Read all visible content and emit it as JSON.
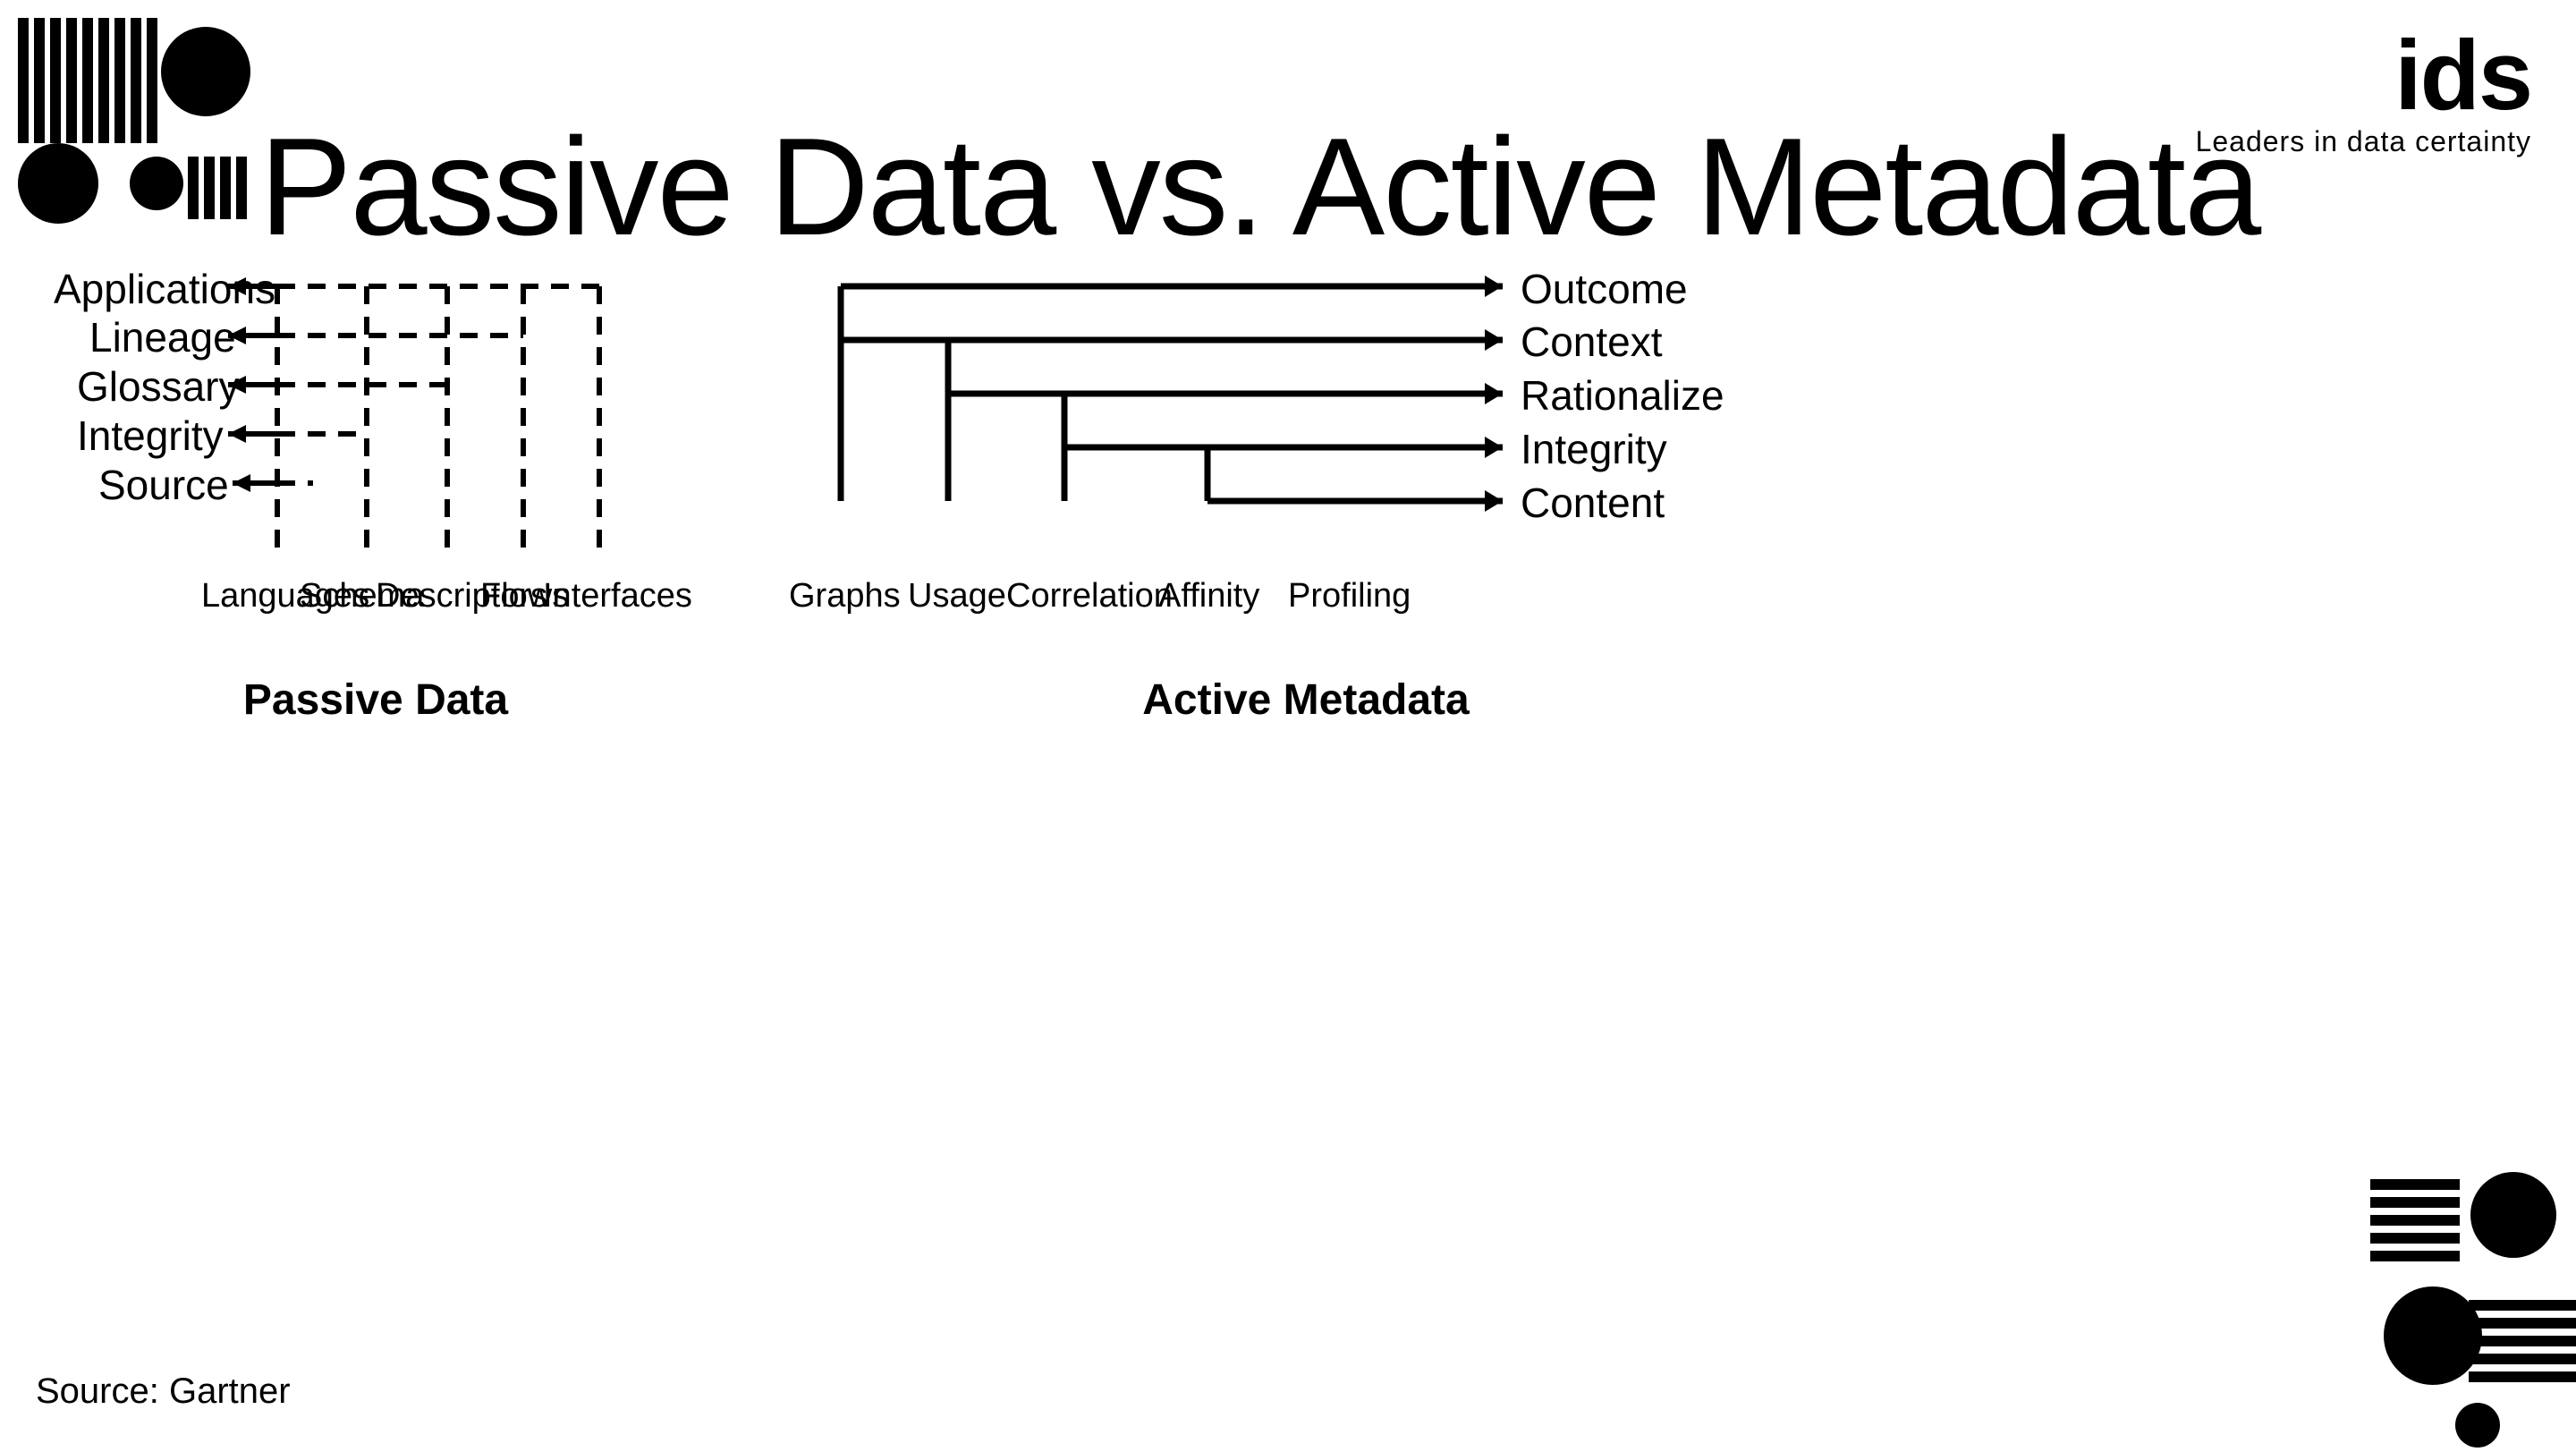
{
  "title": "Passive Data vs. Active Metadata",
  "logo": {
    "ids": "ids",
    "subtitle": "Leaders in data certainty"
  },
  "source": "Source: Gartner",
  "passive": {
    "title": "Passive Data",
    "rows": [
      "Applications",
      "Lineage",
      "Glossary",
      "Integrity",
      "Source"
    ],
    "cols": [
      "Languages",
      "Schema",
      "Descriptors",
      "Flows",
      "Interfaces"
    ]
  },
  "active": {
    "title": "Active Metadata",
    "rows": [
      "Outcome",
      "Context",
      "Rationalize",
      "Integrity",
      "Content"
    ],
    "cols": [
      "Graphs",
      "Usage",
      "Correlation",
      "Affinity",
      "Profiling"
    ]
  }
}
